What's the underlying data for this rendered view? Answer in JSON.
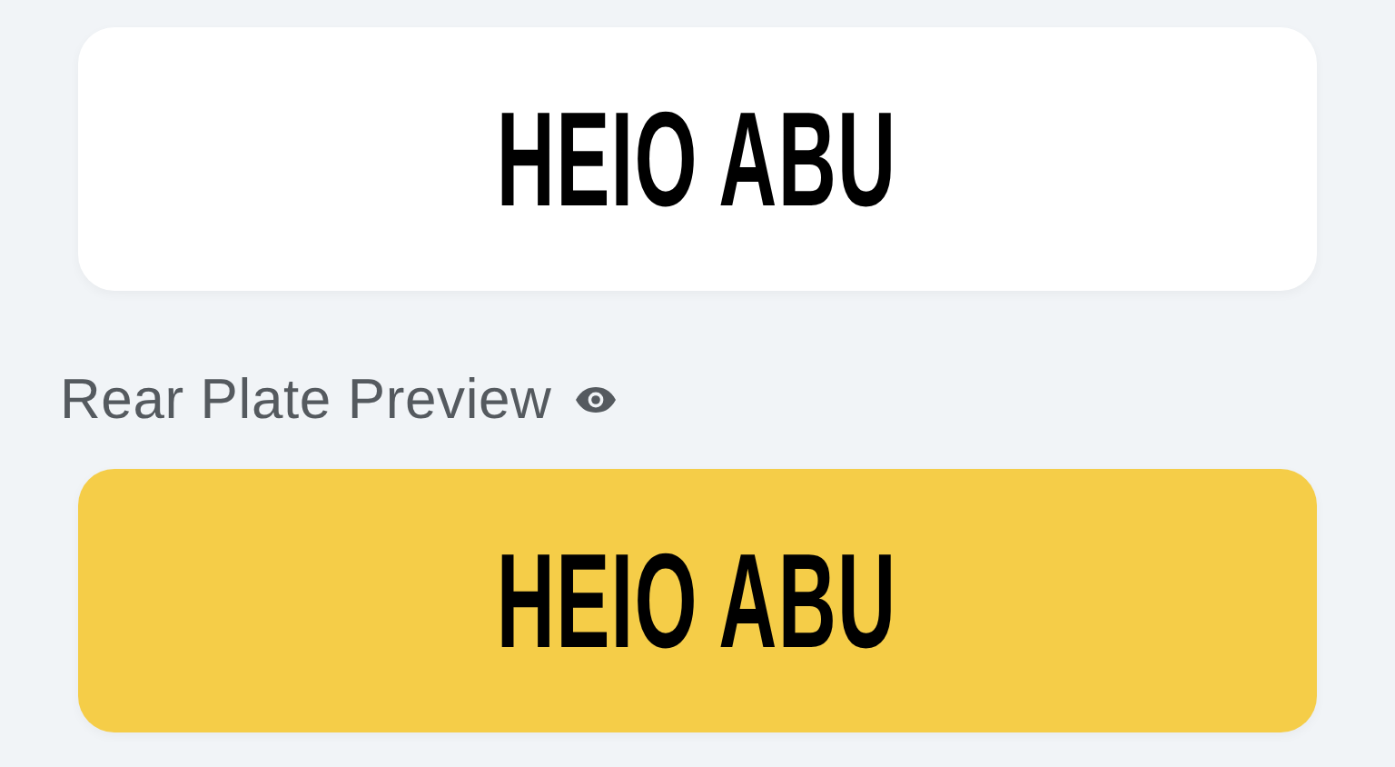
{
  "front_plate": {
    "kind": "front",
    "text": "HEIO ABU"
  },
  "rear_preview": {
    "label": "Rear Plate Preview",
    "plate": {
      "kind": "rear",
      "text": "HEIO ABU"
    }
  }
}
